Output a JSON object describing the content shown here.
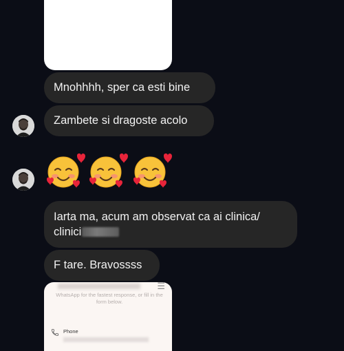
{
  "messages": {
    "m1": "Mnohhhh, sper ca esti bine",
    "m2": "Zambete si dragoste acolo",
    "m3_line1": "Iarta ma, acum am observat ca ai clinica/",
    "m3_line2": "clinici",
    "m4": "F tare. Bravossss"
  },
  "emoji_reaction": {
    "name": "smiling-face-with-hearts",
    "count": 3
  },
  "shared_card": {
    "instruction_text": "WhatsApp for the fastest response, or fill in the form below.",
    "phone_label": "Phone",
    "menu_icon": "hamburger-menu-icon"
  },
  "colors": {
    "background": "#0b0d16",
    "bubble": "#262626",
    "bubble_text": "#f2f2f2"
  }
}
